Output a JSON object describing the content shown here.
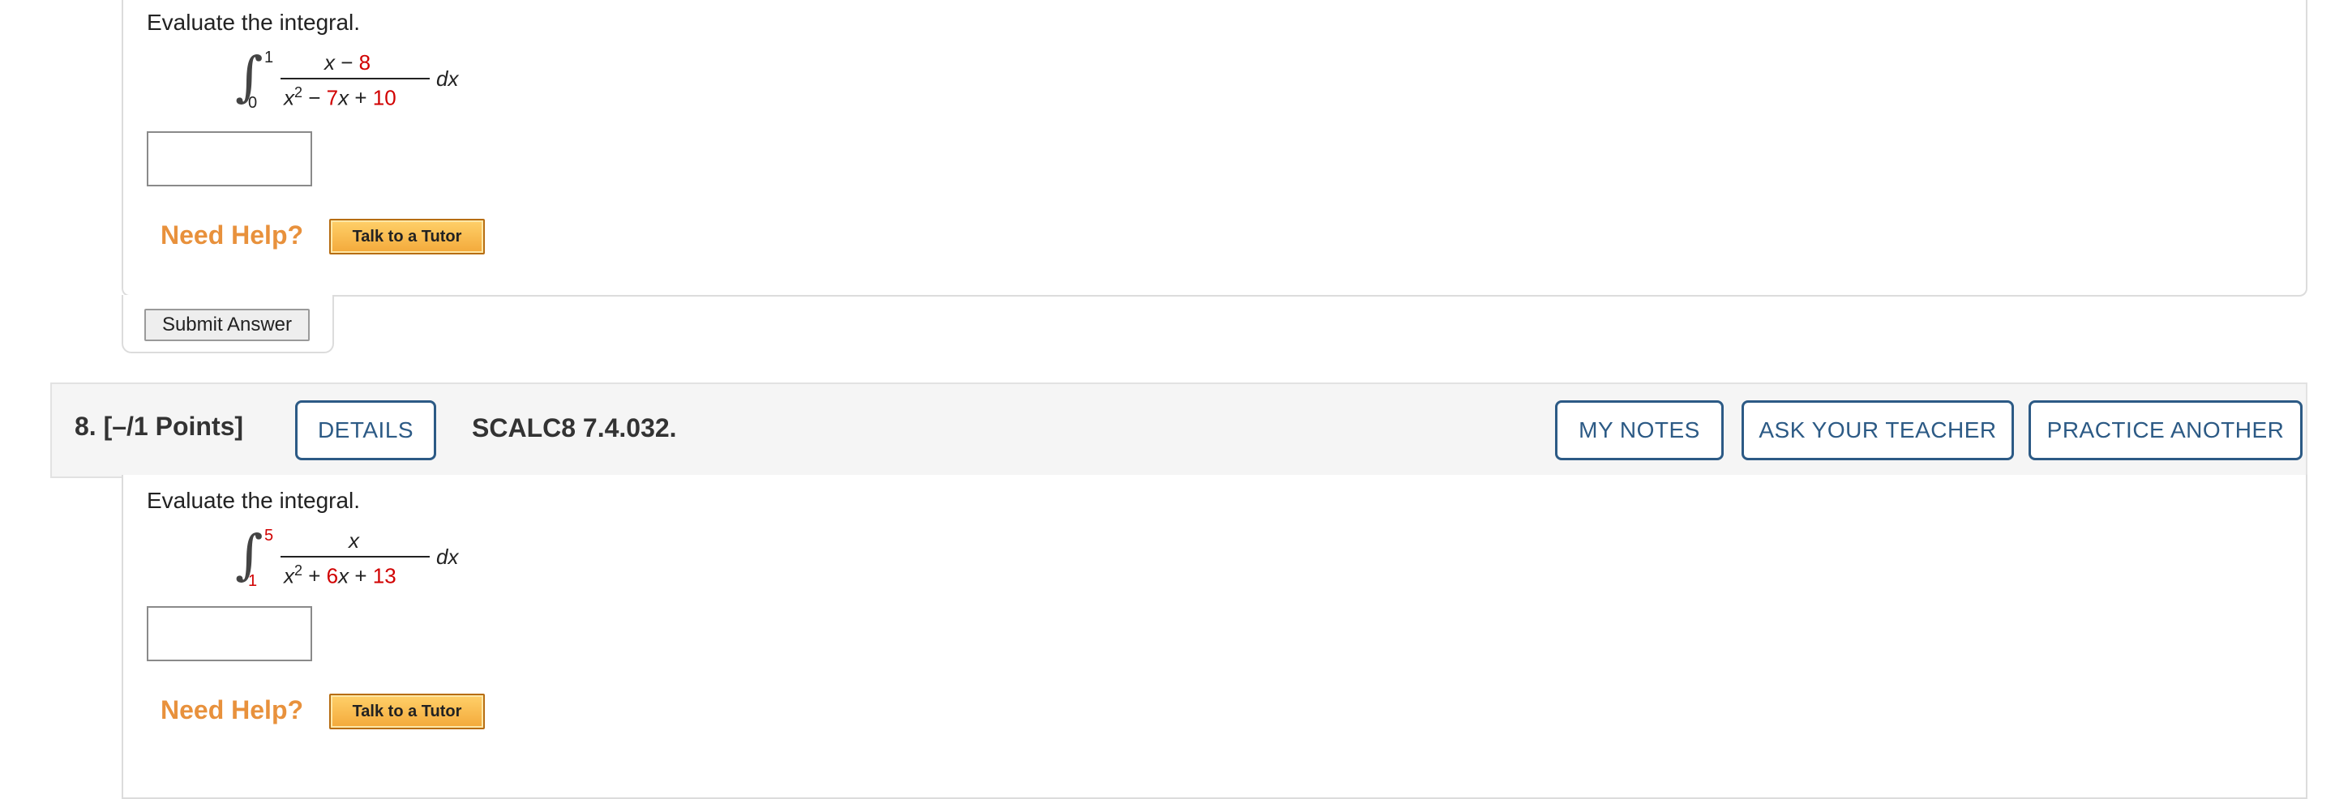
{
  "question7": {
    "prompt": "Evaluate the integral.",
    "integral": {
      "upper_limit": "1",
      "lower_limit": "0",
      "numerator_var": "x",
      "numerator_op": "−",
      "numerator_const": "8",
      "denominator_var": "x",
      "denominator_exp": "2",
      "denominator_op1": "−",
      "denominator_coef": "7",
      "denominator_var2": "x",
      "denominator_op2": "+",
      "denominator_const": "10",
      "differential": "dx"
    },
    "answer_value": "",
    "need_help_label": "Need Help?",
    "tutor_label": "Talk to a Tutor",
    "submit_label": "Submit Answer"
  },
  "question8": {
    "number_label": "8.  [–/1 Points]",
    "details_label": "DETAILS",
    "code": "SCALC8 7.4.032.",
    "my_notes_label": "MY NOTES",
    "ask_teacher_label": "ASK YOUR TEACHER",
    "practice_label": "PRACTICE ANOTHER",
    "prompt": "Evaluate the integral.",
    "integral": {
      "upper_limit": "5",
      "lower_limit": "1",
      "numerator_var": "x",
      "denominator_var": "x",
      "denominator_exp": "2",
      "denominator_op1": "+",
      "denominator_coef": "6",
      "denominator_var2": "x",
      "denominator_op2": "+",
      "denominator_const": "13",
      "differential": "dx"
    },
    "answer_value": "",
    "need_help_label": "Need Help?",
    "tutor_label": "Talk to a Tutor"
  },
  "colors": {
    "accent_blue": "#2c5a85",
    "help_orange": "#e8913c",
    "randomized_red": "#d10000",
    "tutor_button": "#f3a93a"
  }
}
